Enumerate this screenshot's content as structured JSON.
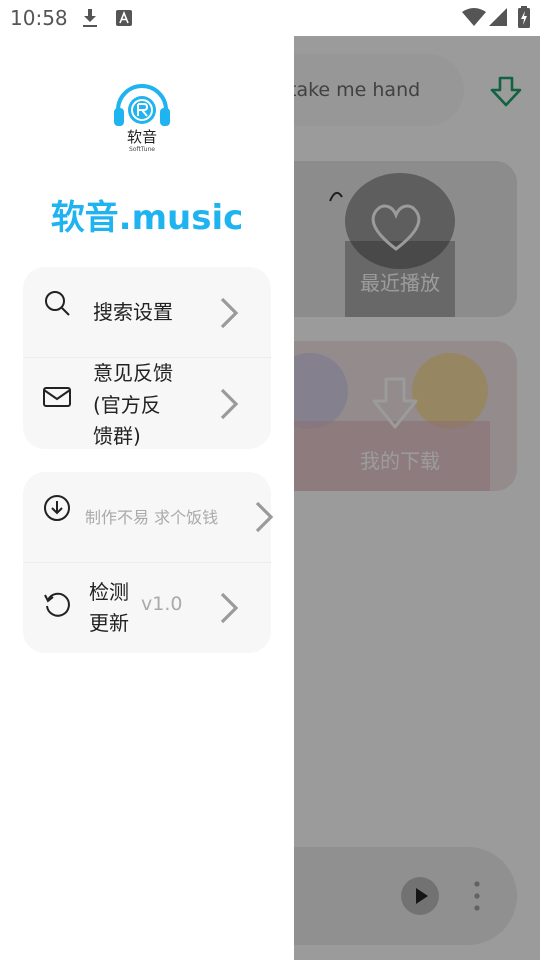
{
  "status_bar": {
    "time": "10:58"
  },
  "drawer": {
    "logo_text": "软音",
    "logo_subtext": "SoftTune",
    "app_title": "软音.music",
    "group1": [
      {
        "label": "搜索设置",
        "icon": "search-icon"
      },
      {
        "label_lines": [
          "意见反馈",
          "(官方反",
          "馈群)"
        ],
        "icon": "mail-icon"
      }
    ],
    "group2": [
      {
        "label": "制作不易 求个饭钱",
        "icon": "download-circle-icon"
      },
      {
        "label_lines": [
          "检测",
          "更新"
        ],
        "value": "v1.0",
        "icon": "refresh-icon"
      }
    ]
  },
  "background": {
    "search_placeholder": "：take me hand",
    "card_recent": "最近播放",
    "card_download": "我的下载"
  },
  "colors": {
    "accent": "#1fb3f0",
    "download_green": "#1a9a6a"
  }
}
